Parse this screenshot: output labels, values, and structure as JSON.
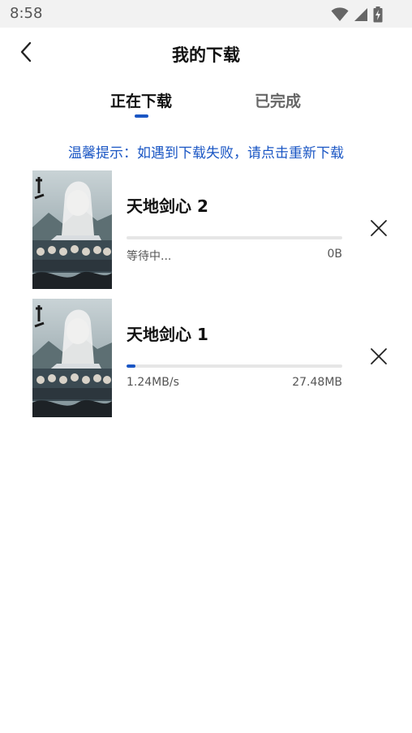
{
  "status_bar": {
    "time": "8:58",
    "icons": [
      "wifi-icon",
      "cellular-signal-icon",
      "battery-charging-icon"
    ]
  },
  "header": {
    "title": "我的下载",
    "back_icon": "chevron-left-icon"
  },
  "tabs": [
    {
      "label": "正在下载",
      "active": true
    },
    {
      "label": "已完成",
      "active": false
    }
  ],
  "tip": "温馨提示：如遇到下载失败，请点击重新下载",
  "downloads": [
    {
      "title": "天地剑心 2",
      "status": "等待中...",
      "size": "0B",
      "progress": 0
    },
    {
      "title": "天地剑心 1",
      "status": "1.24MB/s",
      "size": "27.48MB",
      "progress": 0.04
    }
  ],
  "colors": {
    "accent": "#1a56c4",
    "progress_track": "#e6e6e6",
    "status_bar_bg": "#f2f2f2"
  }
}
